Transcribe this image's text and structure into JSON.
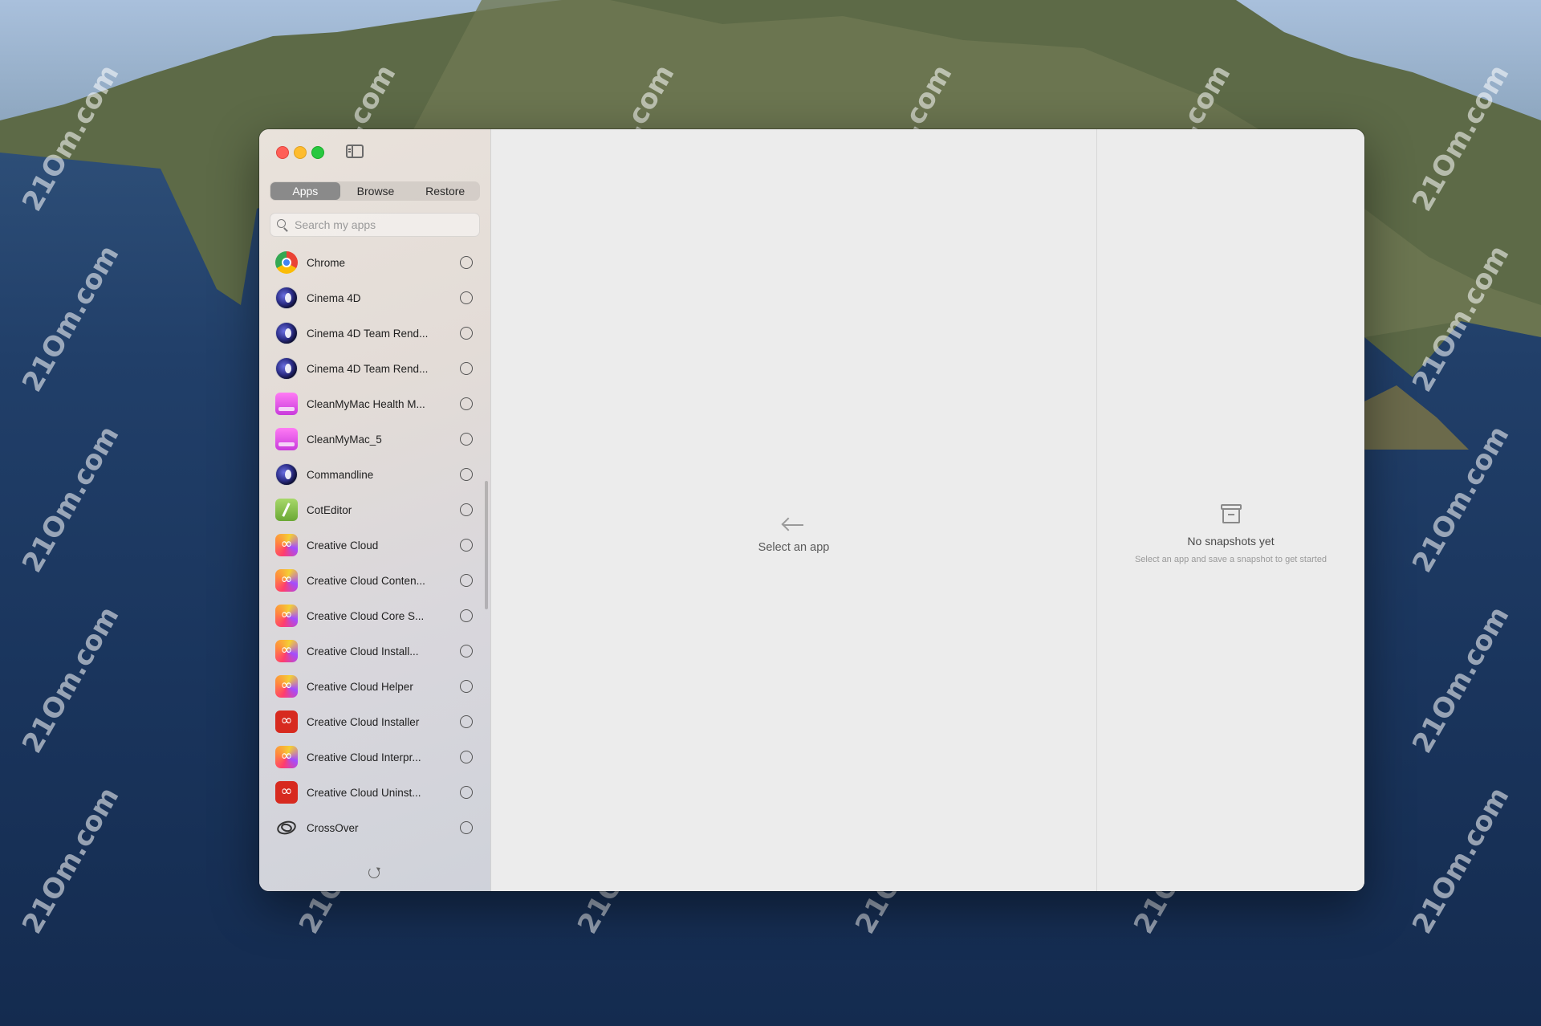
{
  "watermark": "21Om.com",
  "window": {
    "tabs": [
      {
        "label": "Apps",
        "active": true
      },
      {
        "label": "Browse",
        "active": false
      },
      {
        "label": "Restore",
        "active": false
      }
    ],
    "search": {
      "placeholder": "Search my apps",
      "value": ""
    },
    "apps": [
      {
        "name": "Chrome",
        "icon": "chrome-icon"
      },
      {
        "name": "Cinema 4D",
        "icon": "cinema-4d-icon"
      },
      {
        "name": "Cinema 4D Team Rend...",
        "icon": "cinema-4d-icon"
      },
      {
        "name": "Cinema 4D Team Rend...",
        "icon": "cinema-4d-icon"
      },
      {
        "name": "CleanMyMac Health M...",
        "icon": "cleanmymac-icon"
      },
      {
        "name": "CleanMyMac_5",
        "icon": "cleanmymac-icon"
      },
      {
        "name": "Commandline",
        "icon": "cinema-4d-icon"
      },
      {
        "name": "CotEditor",
        "icon": "coteditor-icon"
      },
      {
        "name": "Creative Cloud",
        "icon": "creative-cloud-icon"
      },
      {
        "name": "Creative Cloud Conten...",
        "icon": "creative-cloud-icon"
      },
      {
        "name": "Creative Cloud Core S...",
        "icon": "creative-cloud-icon"
      },
      {
        "name": "Creative Cloud Install...",
        "icon": "creative-cloud-icon"
      },
      {
        "name": "Creative Cloud Helper",
        "icon": "creative-cloud-icon"
      },
      {
        "name": "Creative Cloud Installer",
        "icon": "creative-cloud-installer-icon"
      },
      {
        "name": "Creative Cloud Interpr...",
        "icon": "creative-cloud-icon"
      },
      {
        "name": "Creative Cloud Uninst...",
        "icon": "creative-cloud-installer-icon"
      },
      {
        "name": "CrossOver",
        "icon": "crossover-icon"
      }
    ],
    "main": {
      "placeholder": "Select an app"
    },
    "detail": {
      "title": "No snapshots yet",
      "subtitle": "Select an app and save a snapshot to get started"
    }
  },
  "colors": {
    "accent_segment": "#8a8a8a",
    "close": "#ff5f57",
    "minimize": "#febc2e",
    "zoom": "#28c840"
  }
}
